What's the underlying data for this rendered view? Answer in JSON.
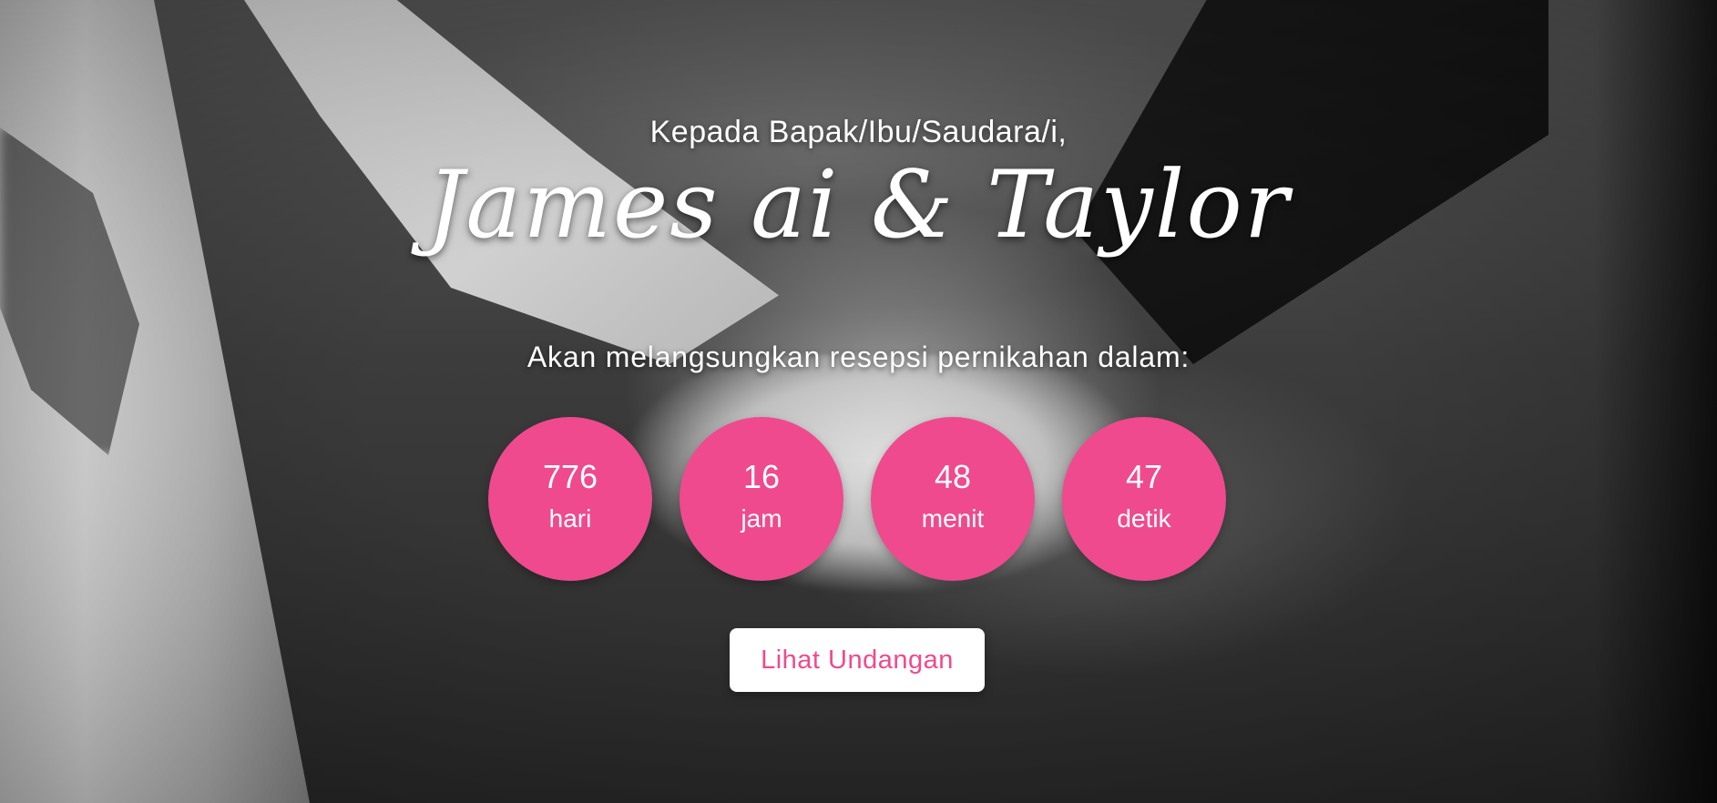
{
  "hero": {
    "greeting": "Kepada Bapak/Ibu/Saudara/i,",
    "names": "James ai & Taylor",
    "subtitle": "Akan melangsungkan resepsi pernikahan dalam:",
    "accent_color": "#ef4a8d",
    "countdown": [
      {
        "value": "776",
        "unit": "hari"
      },
      {
        "value": "16",
        "unit": "jam"
      },
      {
        "value": "48",
        "unit": "menit"
      },
      {
        "value": "47",
        "unit": "detik"
      }
    ],
    "cta_label": "Lihat Undangan"
  }
}
